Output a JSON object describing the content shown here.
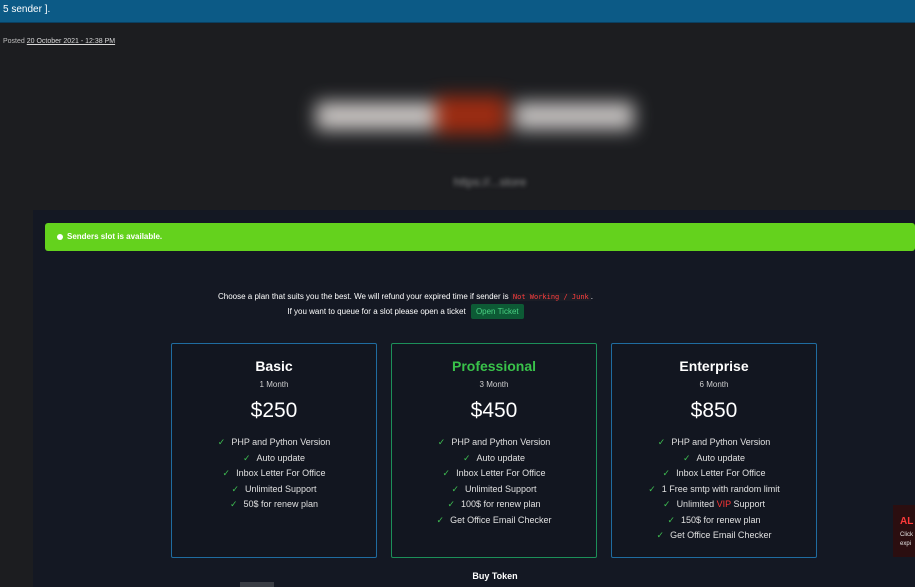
{
  "window": {
    "title": "5 sender ]."
  },
  "post": {
    "posted_label": "Posted",
    "date": "20 October 2021 - 12:38 PM"
  },
  "banner": {
    "url_text": "https://...store"
  },
  "alert": {
    "message": "Senders slot is available."
  },
  "intro": {
    "line1_prefix": "Choose a plan that suits you the best. We will refund your expired time if sender is",
    "status_code": "Not Working / Junk",
    "line1_suffix": ".",
    "line2": "If you want to queue for a slot please open a ticket",
    "ticket_button": "Open Ticket"
  },
  "plans": [
    {
      "name": "Basic",
      "period": "1 Month",
      "price": "$250",
      "features": [
        "PHP and Python Version",
        "Auto update",
        "Inbox Letter For Office",
        "Unlimited Support",
        "50$ for renew plan"
      ]
    },
    {
      "name": "Professional",
      "period": "3 Month",
      "price": "$450",
      "features": [
        "PHP and Python Version",
        "Auto update",
        "Inbox Letter For Office",
        "Unlimited Support",
        "100$ for renew plan",
        "Get Office Email Checker"
      ]
    },
    {
      "name": "Enterprise",
      "period": "6 Month",
      "price": "$850",
      "features": [
        "PHP and Python Version",
        "Auto update",
        "Inbox Letter For Office",
        "1 Free smtp with random limit"
      ],
      "vip_feature": {
        "prefix": "Unlimited",
        "highlight": "VIP",
        "suffix": "Support"
      },
      "features_after": [
        "150$ for renew plan",
        "Get Office Email Checker"
      ]
    }
  ],
  "buy_token": "Buy Token",
  "toast": {
    "title": "AL",
    "line1": "Click",
    "line2": "expi"
  },
  "colors": {
    "alert": "#64d21d",
    "pro_accent": "#39c24a",
    "card_border": "#1f6ca0",
    "warning_red": "#ff3e3e"
  }
}
